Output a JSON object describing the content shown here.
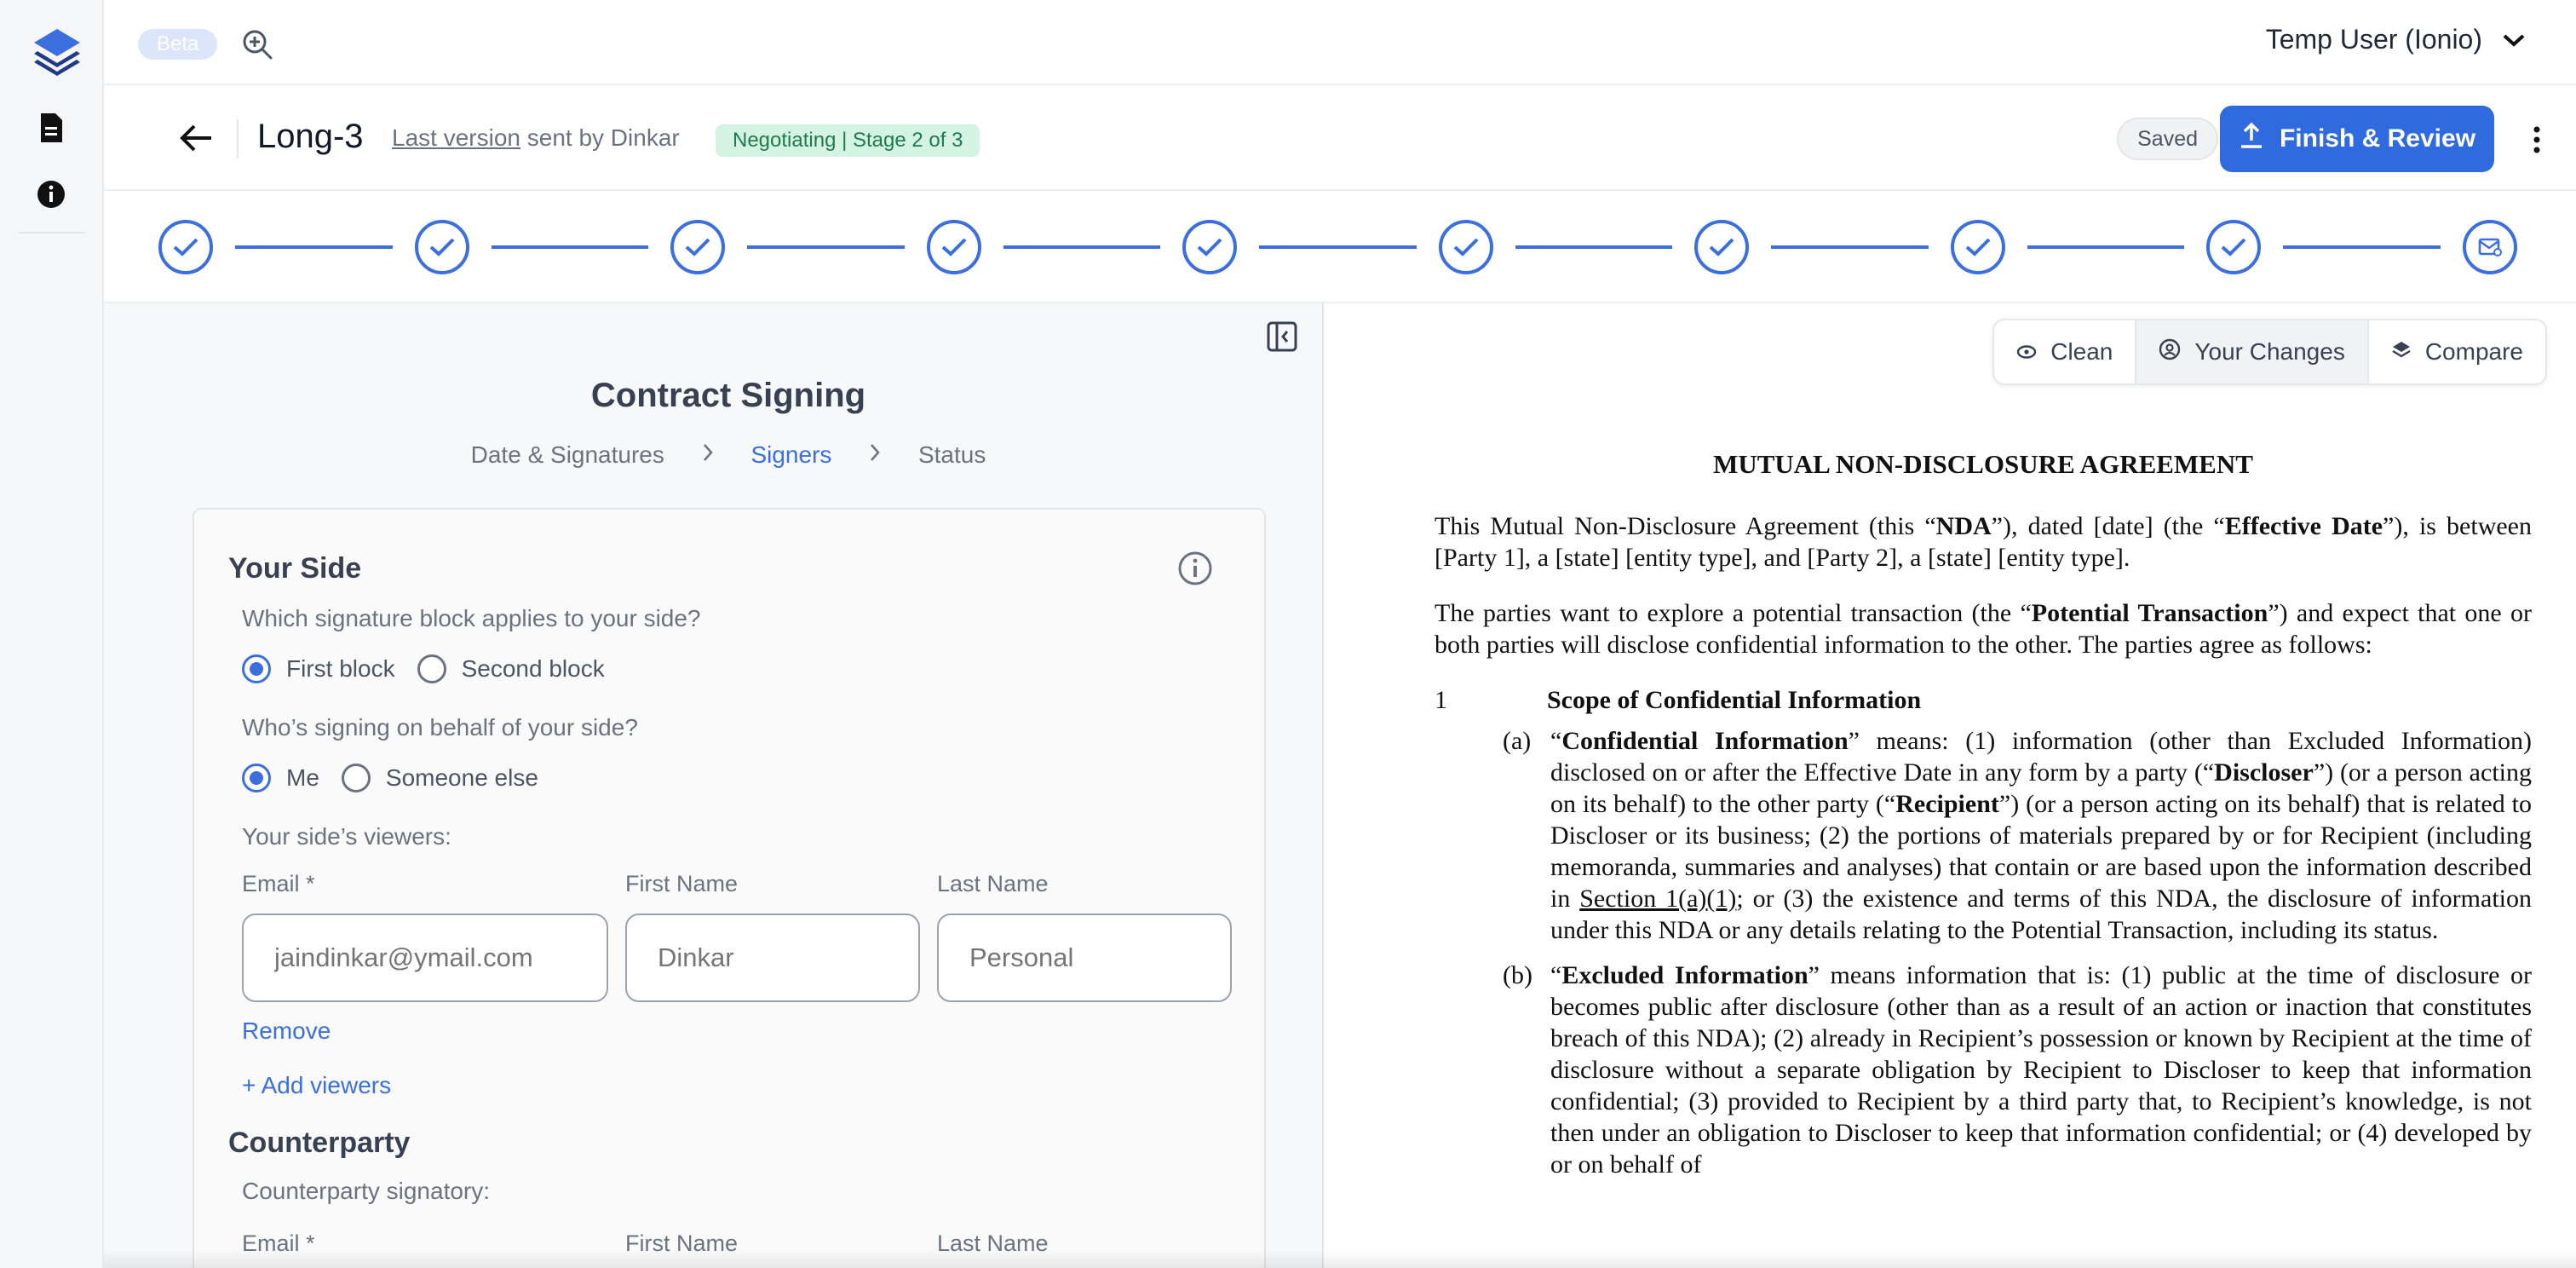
{
  "topbar": {
    "beta_label": "Beta",
    "user_name": "Temp User (Ionio)"
  },
  "doc_header": {
    "title": "Long-3",
    "version_link": "Last version",
    "version_suffix": " sent by Dinkar",
    "stage_badge": "Negotiating | Stage 2 of 3",
    "saved_label": "Saved",
    "finish_label": "Finish & Review"
  },
  "progress": {
    "completed_steps": 9,
    "total_steps": 10
  },
  "signing": {
    "title": "Contract Signing",
    "breadcrumb": [
      "Date & Signatures",
      "Signers",
      "Status"
    ],
    "active_step": "Signers",
    "your_side": {
      "title": "Your Side",
      "q_block": "Which signature block applies to your side?",
      "block_options": [
        "First block",
        "Second block"
      ],
      "block_selected": "First block",
      "q_behalf": "Who’s signing on behalf of your side?",
      "behalf_options": [
        "Me",
        "Someone else"
      ],
      "behalf_selected": "Me",
      "viewers_label": "Your side’s viewers:",
      "email_label": "Email *",
      "first_name_label": "First Name",
      "last_name_label": "Last Name",
      "email_placeholder": "jaindinkar@ymail.com",
      "first_name_placeholder": "Dinkar",
      "last_name_placeholder": "Personal",
      "remove_label": "Remove",
      "add_viewers_label": "+ Add viewers"
    },
    "counterparty": {
      "title": "Counterparty",
      "signatory_label": "Counterparty signatory:",
      "email_label": "Email *",
      "first_name_label": "First Name",
      "last_name_label": "Last Name"
    }
  },
  "view_tabs": {
    "clean": "Clean",
    "your_changes": "Your Changes",
    "compare": "Compare",
    "active": "Your Changes"
  },
  "document": {
    "heading": "MUTUAL NON-DISCLOSURE AGREEMENT",
    "section1_num": "1",
    "section1_title": "Scope of Confidential Information",
    "item_a_mark": "(a)",
    "item_b_mark": "(b)",
    "p1": [
      "This Mutual Non-Disclosure Agreement (this “",
      "NDA",
      "”), dated [date] (the “",
      "Effective Date",
      "”), is between [Party 1], a [state] [entity type], and [Party 2], a [state] [entity type]."
    ],
    "p2": [
      "The parties want to explore a potential transaction (the “",
      "Potential Transaction",
      "”) and expect that one or both parties will disclose confidential information to the other. The parties agree as follows:"
    ],
    "item_a": [
      "“",
      "Confidential Information",
      "” means: (1) information (other than Excluded Information) disclosed on or after the Effective Date in any form by a party (“",
      "Discloser",
      "”) (or a person acting on its behalf) to the other party (“",
      "Recipient",
      "”) (or a person acting on its behalf) that is related to Discloser or its business; (2) the portions of materials prepared by or for Recipient (including memoranda, summaries and analyses) that contain or are based upon the information described in ",
      "Section 1(a)(1)",
      "; or (3) the existence and terms of this NDA, the disclosure of information under this NDA or any details relating to the Potential Transaction, including its status."
    ],
    "item_b": [
      "“",
      "Excluded Information",
      "” means information that is: (1) public at the time of disclosure or becomes public after disclosure (other than as a result of an action or inaction that constitutes breach of this NDA); (2) already in Recipient’s possession or known by Recipient at the time of disclosure without a separate obligation by Recipient to Discloser to keep that information confidential; (3) provided to Recipient by a third party that, to Recipient’s knowledge, is not then under an obligation to Discloser to keep that information confidential; or (4) developed by or on behalf of"
    ]
  },
  "colors": {
    "accent": "#3b6fe0",
    "finish_button": "#2f6bdf",
    "stage_badge_bg": "#d5f3e2",
    "stage_badge_text": "#1f7a4d"
  },
  "icons": {
    "logo": "layers-logo",
    "nav1": "document-icon",
    "nav2": "info-icon",
    "zoom": "zoom-in-icon",
    "back": "arrow-left-icon",
    "finish": "upload-icon",
    "last_step": "envelope-icon"
  }
}
